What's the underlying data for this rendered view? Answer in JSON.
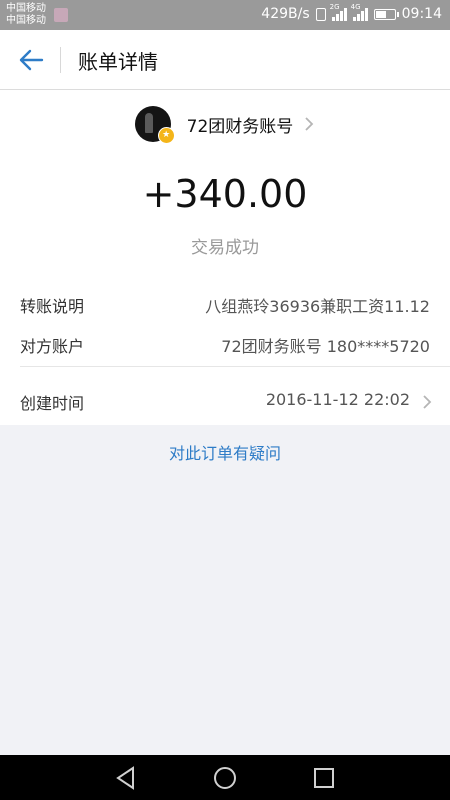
{
  "status_bar": {
    "carrier_1": "中国移动",
    "carrier_2": "中国移动",
    "net_speed": "429B/s",
    "sim1_tag": "2G",
    "sim2_tag": "4G",
    "time": "09:14",
    "battery_level": 0.6
  },
  "header": {
    "title": "账单详情"
  },
  "bill": {
    "payee_name": "72团财务账号",
    "amount": "+340.00",
    "status": "交易成功",
    "rows": [
      {
        "label": "转账说明",
        "value": "八组燕玲36936兼职工资11.12"
      },
      {
        "label": "对方账户",
        "value": "72团财务账号 180****5720"
      },
      {
        "label": "创建时间",
        "value": "2016-11-12 22:02"
      }
    ]
  },
  "question_link": "对此订单有疑问",
  "colors": {
    "accent": "#2e7cc7",
    "page_bg": "#f1f2f6",
    "status_bar": "#9a9a9a"
  },
  "icons": {
    "back": "arrow-left-icon",
    "payee_chevron": "chevron-right-icon",
    "row_chevron": "chevron-right-icon",
    "nav_back": "triangle-back-icon",
    "nav_home": "circle-home-icon",
    "nav_recent": "square-recent-icon"
  }
}
